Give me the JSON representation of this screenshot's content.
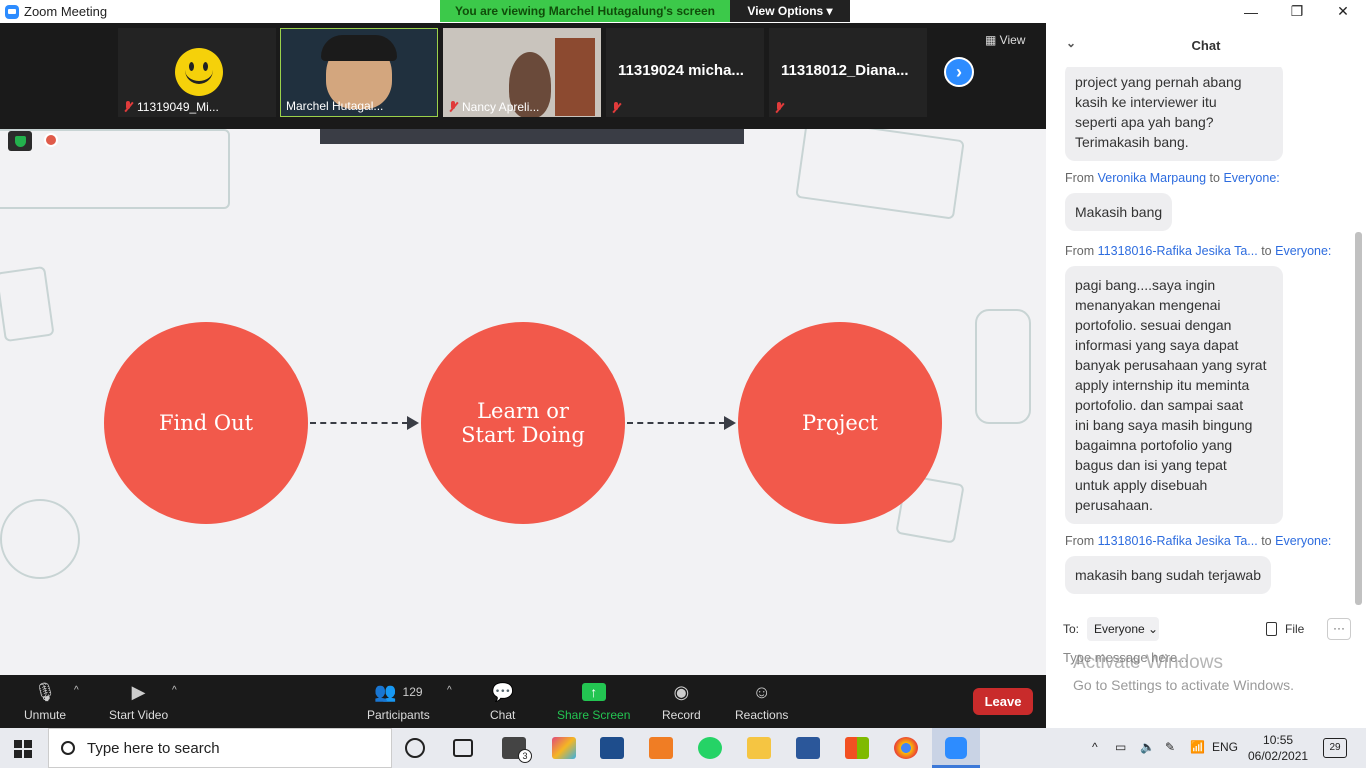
{
  "window": {
    "title": "Zoom Meeting"
  },
  "banner": {
    "message": "You are viewing Marchel Hutagalung's screen",
    "view_options": "View Options ▾"
  },
  "participants_strip": {
    "tiles": [
      {
        "name": "11319049_Mi..."
      },
      {
        "name": "Marchel Hutagal..."
      },
      {
        "name": "Nancy Apreli..."
      },
      {
        "name": "11319024 micha..."
      },
      {
        "name": "11318012_Diana..."
      }
    ],
    "view_label": "View"
  },
  "slide": {
    "steps": [
      "Find Out",
      "Learn or\nStart Doing",
      "Project"
    ],
    "colors": {
      "circle": "#f2594b",
      "connector": "#3a3d45",
      "background": "#f2f2f4"
    }
  },
  "toolbar": {
    "unmute": "Unmute",
    "start_video": "Start Video",
    "participants": "Participants",
    "participants_count": "129",
    "chat": "Chat",
    "share_screen": "Share Screen",
    "record": "Record",
    "reactions": "Reactions",
    "leave": "Leave"
  },
  "chat": {
    "title": "Chat",
    "messages": [
      {
        "text": "project yang pernah abang\nkasih ke interviewer itu\nseperti apa yah bang?\nTerimakasih bang."
      },
      {
        "from_prefix": "From",
        "sender": "Veronika Marpaung",
        "to_word": "to",
        "recipient": "Everyone:",
        "text": "Makasih bang"
      },
      {
        "from_prefix": "From",
        "sender": "11318016-Rafika Jesika Ta...",
        "to_word": "to",
        "recipient": "Everyone:",
        "text": "pagi bang....saya ingin\nmenanyakan mengenai\nportofolio. sesuai dengan\ninformasi yang saya dapat\nbanyak perusahaan yang syrat\napply internship itu meminta\nportofolio. dan sampai saat\nini bang saya masih bingung\nbagaimna portofolio yang\nbagus dan isi yang tepat\nuntuk apply disebuah\nperusahaan."
      },
      {
        "from_prefix": "From",
        "sender": "11318016-Rafika Jesika Ta...",
        "to_word": "to",
        "recipient": "Everyone:",
        "text": "makasih bang sudah terjawab"
      }
    ],
    "to_label": "To:",
    "recipient_select": "Everyone",
    "file_label": "File",
    "more_label": "···",
    "input_placeholder": "Type message here..."
  },
  "watermark": {
    "line1": "Activate Windows",
    "line2": "Go to Settings to activate Windows."
  },
  "taskbar": {
    "search_placeholder": "Type here to search",
    "mail_badge": "3",
    "language": "ENG",
    "time": "10:55",
    "date": "06/02/2021",
    "notifications": "29"
  }
}
